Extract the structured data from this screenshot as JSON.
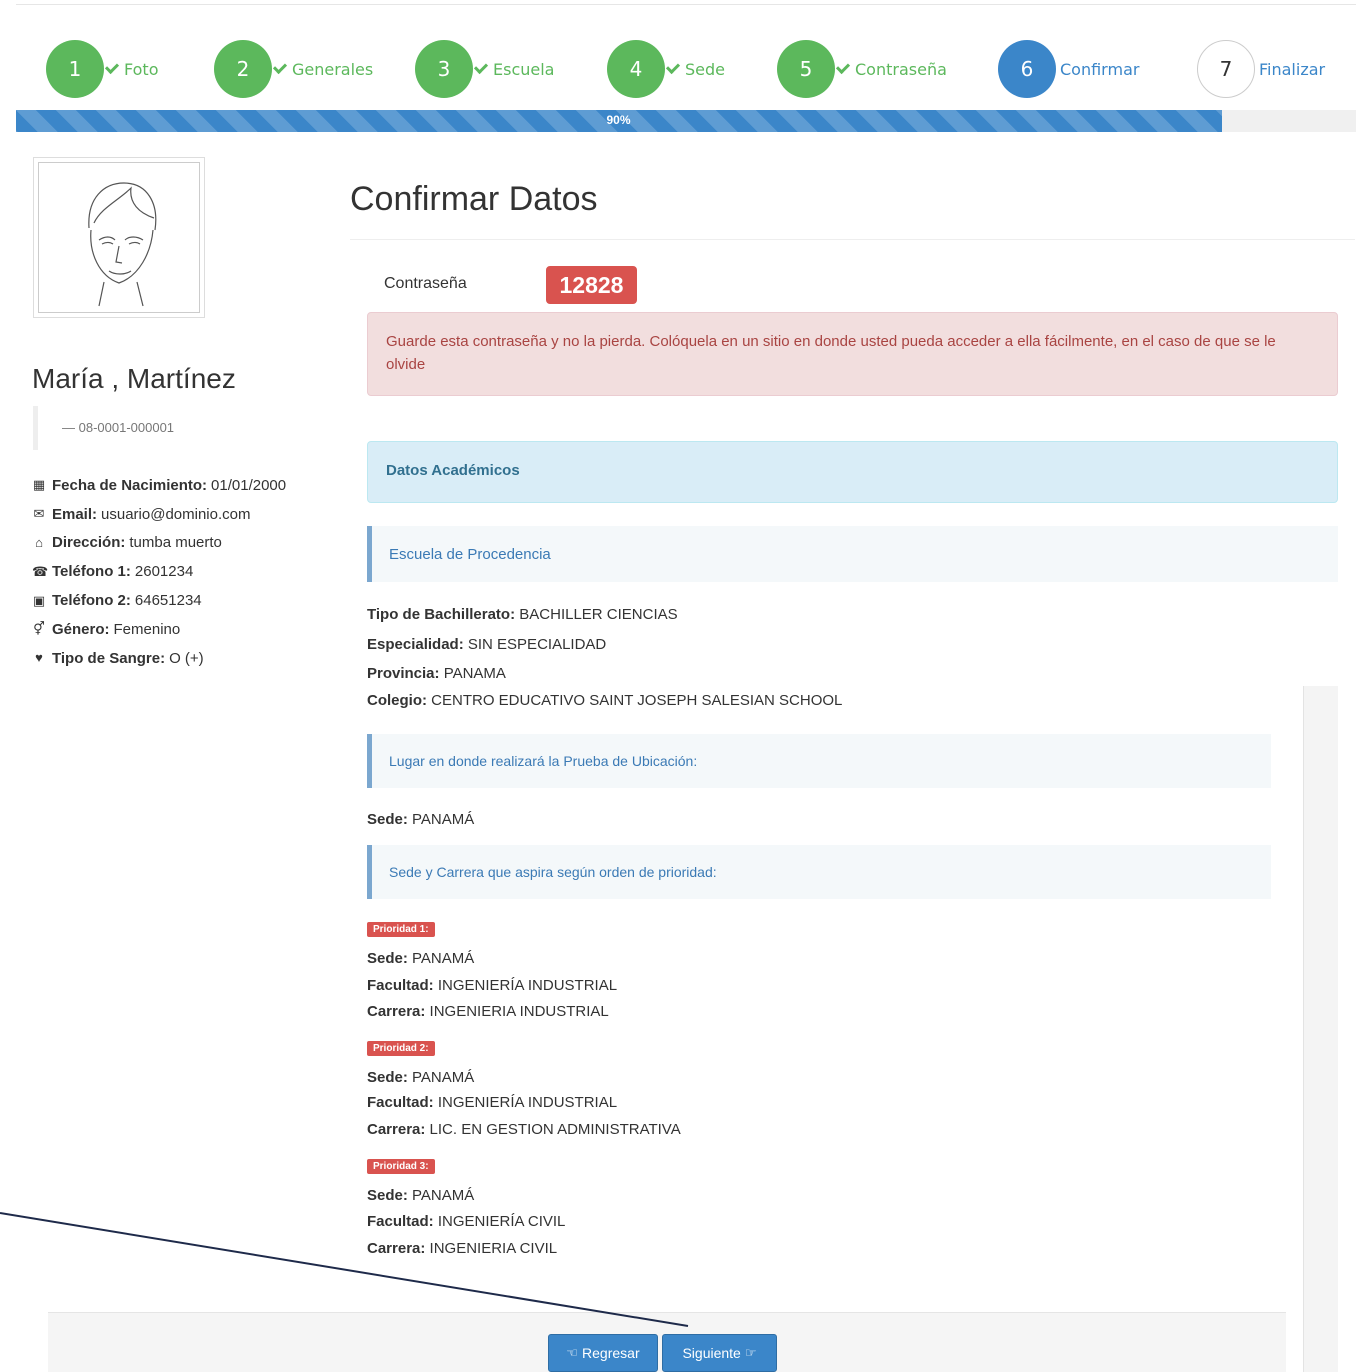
{
  "steps": [
    {
      "number": "1",
      "label": "Foto",
      "state": "done"
    },
    {
      "number": "2",
      "label": "Generales",
      "state": "done"
    },
    {
      "number": "3",
      "label": "Escuela",
      "state": "done"
    },
    {
      "number": "4",
      "label": "Sede",
      "state": "done"
    },
    {
      "number": "5",
      "label": "Contraseña",
      "state": "done"
    },
    {
      "number": "6",
      "label": "Confirmar",
      "state": "active"
    },
    {
      "number": "7",
      "label": "Finalizar",
      "state": "todo"
    }
  ],
  "progress": {
    "label": "90%",
    "value": 0.9,
    "color": "#3b86c9"
  },
  "profile": {
    "name": "María , Martínez",
    "id": "— 08-0001-000001",
    "fields": [
      {
        "icon": "calendar-icon",
        "label": "Fecha de Nacimiento:",
        "value": "01/01/2000"
      },
      {
        "icon": "envelope-icon",
        "label": "Email:",
        "value": "usuario@dominio.com"
      },
      {
        "icon": "home-icon",
        "label": "Dirección:",
        "value": "tumba muerto"
      },
      {
        "icon": "phone-icon",
        "label": "Teléfono 1:",
        "value": "2601234"
      },
      {
        "icon": "phone-square-icon",
        "label": "Teléfono 2:",
        "value": "64651234"
      },
      {
        "icon": "gender-icon",
        "label": "Género:",
        "value": "Femenino"
      },
      {
        "icon": "heart-icon",
        "label": "Tipo de Sangre:",
        "value": "O (+)"
      }
    ]
  },
  "main": {
    "title": "Confirmar Datos",
    "password_label": "Contraseña",
    "password_value": "12828",
    "password_warning": "Guarde esta contraseña y no la pierda. Colóquela en un sitio en donde usted pueda acceder a ella fácilmente, en el caso de que se le olvide",
    "academic_header": "Datos Académicos",
    "school_header": "Escuela de Procedencia",
    "school": [
      {
        "label": "Tipo de Bachillerato:",
        "value": "BACHILLER CIENCIAS"
      },
      {
        "label": "Especialidad:",
        "value": "SIN ESPECIALIDAD"
      },
      {
        "label": "Provincia:",
        "value": "PANAMA"
      },
      {
        "label": "Colegio:",
        "value": "CENTRO EDUCATIVO SAINT JOSEPH SALESIAN SCHOOL"
      }
    ],
    "test_place_header": "Lugar en donde realizará la Prueba de Ubicación:",
    "test_place": {
      "label": "Sede:",
      "value": "PANAMÁ"
    },
    "priority_header": "Sede y Carrera que aspira según orden de prioridad:",
    "priorities": [
      {
        "badge": "Prioridad 1:",
        "sede_label": "Sede:",
        "sede": "PANAMÁ",
        "facultad_label": "Facultad:",
        "facultad": "INGENIERÍA INDUSTRIAL",
        "carrera_label": "Carrera:",
        "carrera": "INGENIERIA INDUSTRIAL"
      },
      {
        "badge": "Prioridad 2:",
        "sede_label": "Sede:",
        "sede": "PANAMÁ",
        "facultad_label": "Facultad:",
        "facultad": "INGENIERÍA INDUSTRIAL",
        "carrera_label": "Carrera:",
        "carrera": "LIC. EN GESTION ADMINISTRATIVA"
      },
      {
        "badge": "Prioridad 3:",
        "sede_label": "Sede:",
        "sede": "PANAMÁ",
        "facultad_label": "Facultad:",
        "facultad": "INGENIERÍA CIVIL",
        "carrera_label": "Carrera:",
        "carrera": "INGENIERIA CIVIL"
      }
    ]
  },
  "footer": {
    "back_label": "Regresar",
    "next_label": "Siguiente"
  }
}
